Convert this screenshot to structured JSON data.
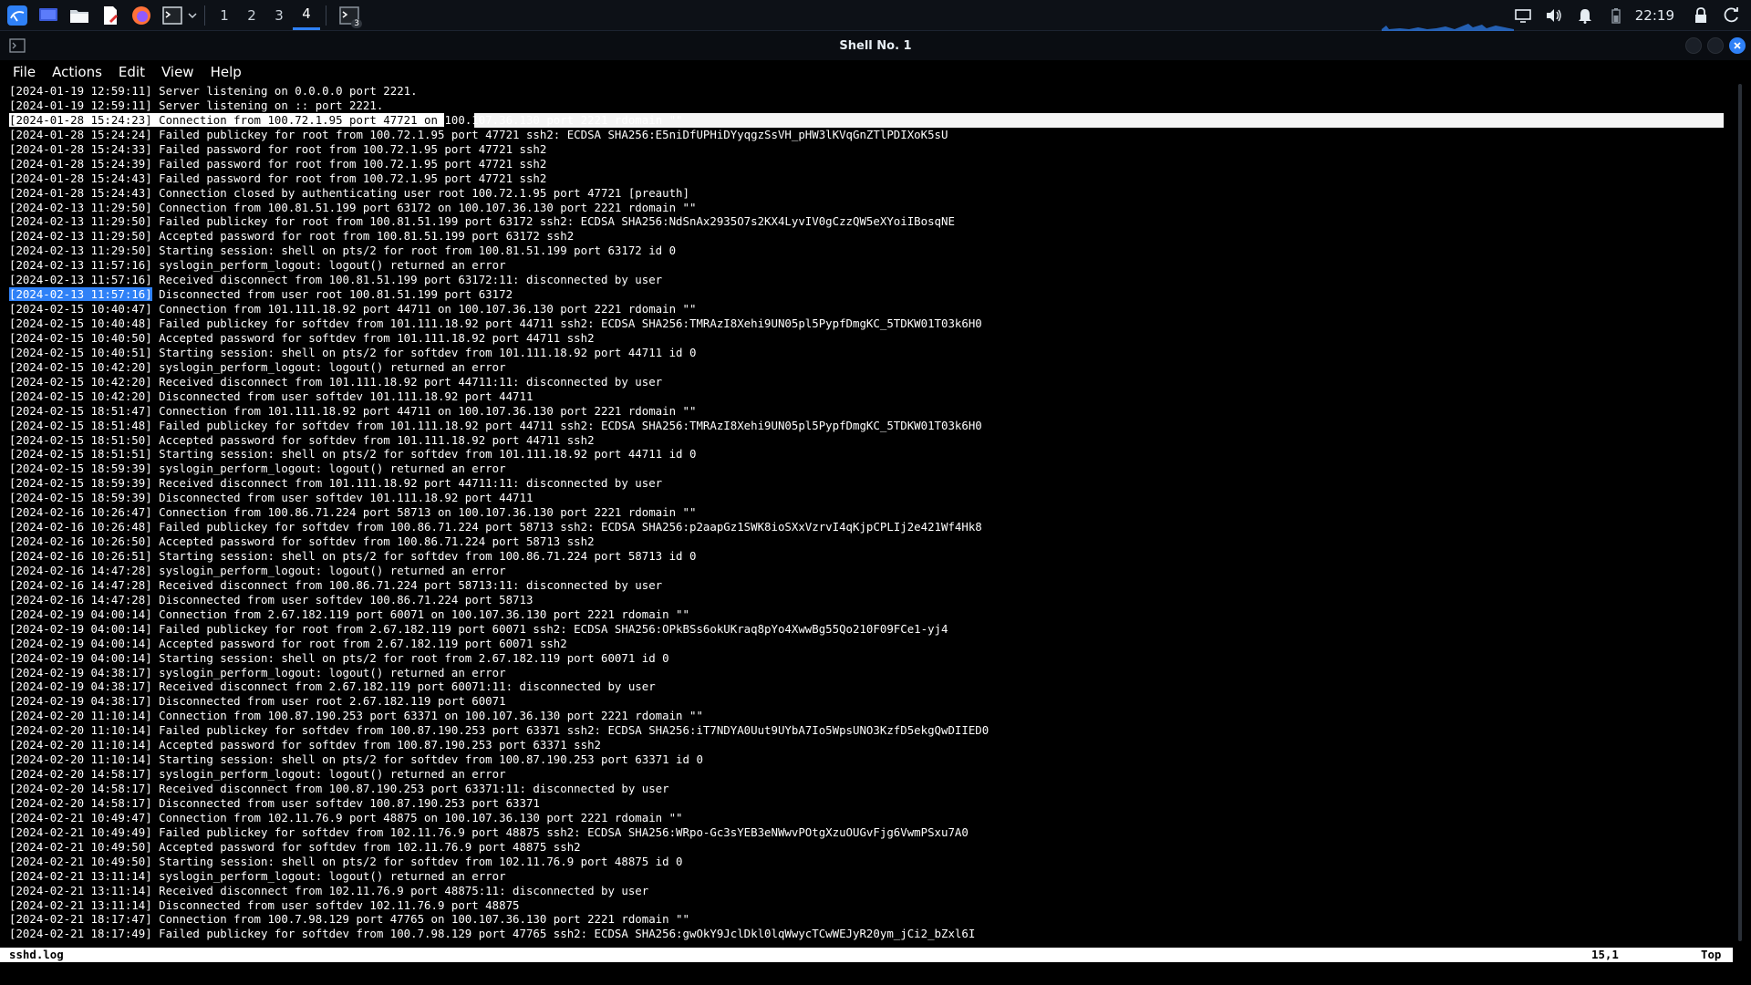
{
  "taskbar": {
    "workspaces": [
      "1",
      "2",
      "3",
      "4"
    ],
    "active_workspace": "4",
    "clock": "22:19",
    "terminal_badge": "3",
    "accent": "#2f81f7"
  },
  "window": {
    "title": "Shell No. 1",
    "menu": [
      "File",
      "Actions",
      "Edit",
      "View",
      "Help"
    ]
  },
  "terminal": {
    "lines": [
      "[2024-01-19 12:59:11] Server listening on 0.0.0.0 port 2221.",
      "[2024-01-19 12:59:11] Server listening on :: port 2221.",
      "[2024-01-28 15:24:23] Connection from 100.72.1.95 port 47721 on 100.107.36.130 port 2221 rdomain \"\"",
      "[2024-01-28 15:24:24] Failed publickey for root from 100.72.1.95 port 47721 ssh2: ECDSA SHA256:E5niDfUPHiDYyqgzSsVH_pHW3lKVqGnZTlPDIXoK5sU",
      "[2024-01-28 15:24:33] Failed password for root from 100.72.1.95 port 47721 ssh2",
      "[2024-01-28 15:24:39] Failed password for root from 100.72.1.95 port 47721 ssh2",
      "[2024-01-28 15:24:43] Failed password for root from 100.72.1.95 port 47721 ssh2",
      "[2024-01-28 15:24:43] Connection closed by authenticating user root 100.72.1.95 port 47721 [preauth]",
      "[2024-02-13 11:29:50] Connection from 100.81.51.199 port 63172 on 100.107.36.130 port 2221 rdomain \"\"",
      "[2024-02-13 11:29:50] Failed publickey for root from 100.81.51.199 port 63172 ssh2: ECDSA SHA256:NdSnAx2935O7s2KX4LyvIV0gCzzQW5eXYoiIBosqNE",
      "[2024-02-13 11:29:50] Accepted password for root from 100.81.51.199 port 63172 ssh2",
      "[2024-02-13 11:29:50] Starting session: shell on pts/2 for root from 100.81.51.199 port 63172 id 0",
      "[2024-02-13 11:57:16] syslogin_perform_logout: logout() returned an error",
      "[2024-02-13 11:57:16] Received disconnect from 100.81.51.199 port 63172:11: disconnected by user",
      "[2024-02-13 11:57:16] Disconnected from user root 100.81.51.199 port 63172",
      "[2024-02-15 10:40:47] Connection from 101.111.18.92 port 44711 on 100.107.36.130 port 2221 rdomain \"\"",
      "[2024-02-15 10:40:48] Failed publickey for softdev from 101.111.18.92 port 44711 ssh2: ECDSA SHA256:TMRAzI8Xehi9UN05pl5PypfDmgKC_5TDKW01T03k6H0",
      "[2024-02-15 10:40:50] Accepted password for softdev from 101.111.18.92 port 44711 ssh2",
      "[2024-02-15 10:40:51] Starting session: shell on pts/2 for softdev from 101.111.18.92 port 44711 id 0",
      "[2024-02-15 10:42:20] syslogin_perform_logout: logout() returned an error",
      "[2024-02-15 10:42:20] Received disconnect from 101.111.18.92 port 44711:11: disconnected by user",
      "[2024-02-15 10:42:20] Disconnected from user softdev 101.111.18.92 port 44711",
      "[2024-02-15 18:51:47] Connection from 101.111.18.92 port 44711 on 100.107.36.130 port 2221 rdomain \"\"",
      "[2024-02-15 18:51:48] Failed publickey for softdev from 101.111.18.92 port 44711 ssh2: ECDSA SHA256:TMRAzI8Xehi9UN05pl5PypfDmgKC_5TDKW01T03k6H0",
      "[2024-02-15 18:51:50] Accepted password for softdev from 101.111.18.92 port 44711 ssh2",
      "[2024-02-15 18:51:51] Starting session: shell on pts/2 for softdev from 101.111.18.92 port 44711 id 0",
      "[2024-02-15 18:59:39] syslogin_perform_logout: logout() returned an error",
      "[2024-02-15 18:59:39] Received disconnect from 101.111.18.92 port 44711:11: disconnected by user",
      "[2024-02-15 18:59:39] Disconnected from user softdev 101.111.18.92 port 44711",
      "[2024-02-16 10:26:47] Connection from 100.86.71.224 port 58713 on 100.107.36.130 port 2221 rdomain \"\"",
      "[2024-02-16 10:26:48] Failed publickey for softdev from 100.86.71.224 port 58713 ssh2: ECDSA SHA256:p2aapGz1SWK8ioSXxVzrvI4qKjpCPLIj2e421Wf4Hk8",
      "[2024-02-16 10:26:50] Accepted password for softdev from 100.86.71.224 port 58713 ssh2",
      "[2024-02-16 10:26:51] Starting session: shell on pts/2 for softdev from 100.86.71.224 port 58713 id 0",
      "[2024-02-16 14:47:28] syslogin_perform_logout: logout() returned an error",
      "[2024-02-16 14:47:28] Received disconnect from 100.86.71.224 port 58713:11: disconnected by user",
      "[2024-02-16 14:47:28] Disconnected from user softdev 100.86.71.224 port 58713",
      "[2024-02-19 04:00:14] Connection from 2.67.182.119 port 60071 on 100.107.36.130 port 2221 rdomain \"\"",
      "[2024-02-19 04:00:14] Failed publickey for root from 2.67.182.119 port 60071 ssh2: ECDSA SHA256:OPkBSs6okUKraq8pYo4XwwBg55Qo210F09FCe1-yj4",
      "[2024-02-19 04:00:14] Accepted password for root from 2.67.182.119 port 60071 ssh2",
      "[2024-02-19 04:00:14] Starting session: shell on pts/2 for root from 2.67.182.119 port 60071 id 0",
      "[2024-02-19 04:38:17] syslogin_perform_logout: logout() returned an error",
      "[2024-02-19 04:38:17] Received disconnect from 2.67.182.119 port 60071:11: disconnected by user",
      "[2024-02-19 04:38:17] Disconnected from user root 2.67.182.119 port 60071",
      "[2024-02-20 11:10:14] Connection from 100.87.190.253 port 63371 on 100.107.36.130 port 2221 rdomain \"\"",
      "[2024-02-20 11:10:14] Failed publickey for softdev from 100.87.190.253 port 63371 ssh2: ECDSA SHA256:iT7NDYA0Uut9UYbA7Io5WpsUNO3KzfD5ekgQwDIIED0",
      "[2024-02-20 11:10:14] Accepted password for softdev from 100.87.190.253 port 63371 ssh2",
      "[2024-02-20 11:10:14] Starting session: shell on pts/2 for softdev from 100.87.190.253 port 63371 id 0",
      "[2024-02-20 14:58:17] syslogin_perform_logout: logout() returned an error",
      "[2024-02-20 14:58:17] Received disconnect from 100.87.190.253 port 63371:11: disconnected by user",
      "[2024-02-20 14:58:17] Disconnected from user softdev 100.87.190.253 port 63371",
      "[2024-02-21 10:49:47] Connection from 102.11.76.9 port 48875 on 100.107.36.130 port 2221 rdomain \"\"",
      "[2024-02-21 10:49:49] Failed publickey for softdev from 102.11.76.9 port 48875 ssh2: ECDSA SHA256:WRpo-Gc3sYEB3eNWwvPOtgXzuOUGvFjg6VwmPSxu7A0",
      "[2024-02-21 10:49:50] Accepted password for softdev from 102.11.76.9 port 48875 ssh2",
      "[2024-02-21 10:49:50] Starting session: shell on pts/2 for softdev from 102.11.76.9 port 48875 id 0",
      "[2024-02-21 13:11:14] syslogin_perform_logout: logout() returned an error",
      "[2024-02-21 13:11:14] Received disconnect from 102.11.76.9 port 48875:11: disconnected by user",
      "[2024-02-21 13:11:14] Disconnected from user softdev 102.11.76.9 port 48875",
      "[2024-02-21 18:17:47] Connection from 100.7.98.129 port 47765 on 100.107.36.130 port 2221 rdomain \"\"",
      "[2024-02-21 18:17:49] Failed publickey for softdev from 100.7.98.129 port 47765 ssh2: ECDSA SHA256:gwOkY9JclDkl0lqWwycTCwWEJyR20ym_jCi2_bZxl6I"
    ],
    "highlighted_line": 2,
    "highlighted_prefix": "[2024-01-28 15:24:23] Connection from 100.72.1.95 port 47721 on ",
    "cursor_line": 14
  },
  "statusline": {
    "filename": "sshd.log",
    "position": "15,1",
    "scroll": "Top"
  }
}
